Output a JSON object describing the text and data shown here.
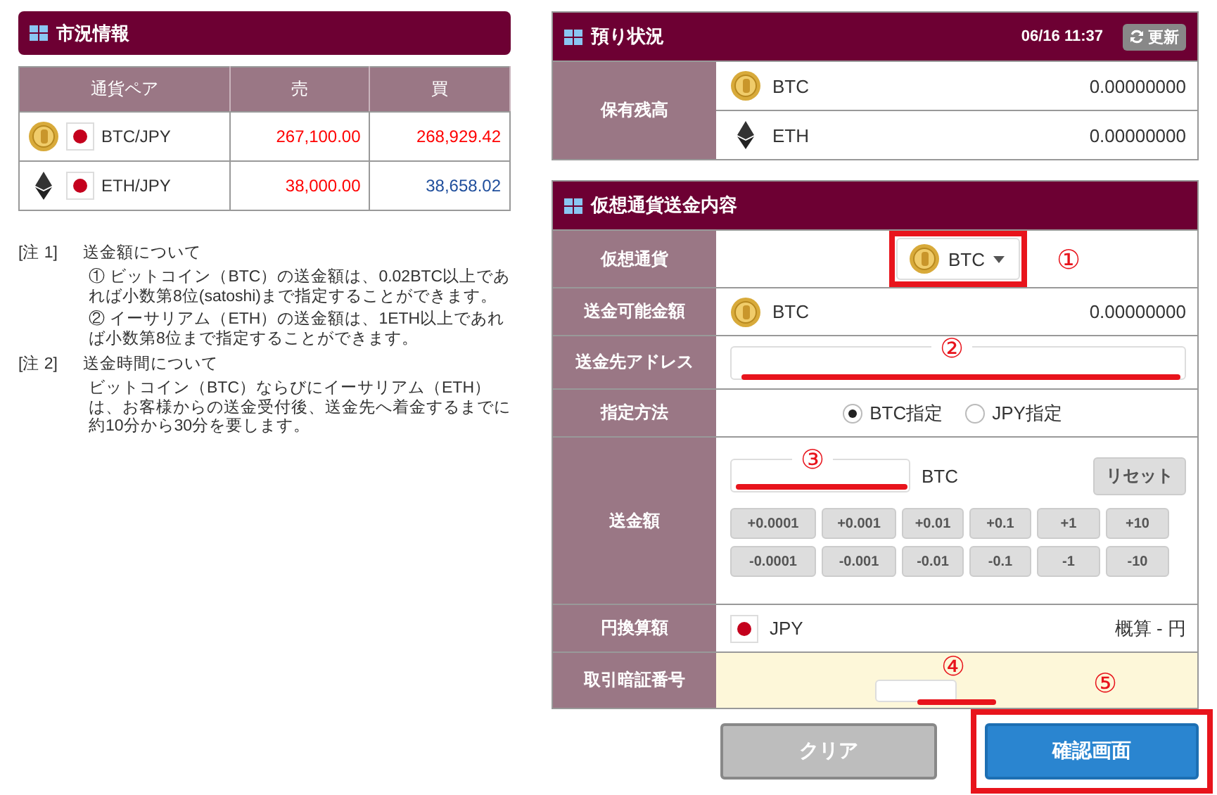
{
  "market": {
    "title": "市況情報",
    "columns": [
      "通貨ペア",
      "売",
      "買"
    ],
    "rows": [
      {
        "kind": "btc",
        "pair": "BTC/JPY",
        "sell": {
          "text": "267,100.00",
          "color": "#ff0000"
        },
        "buy": {
          "text": "268,929.42",
          "color": "#ff0000"
        }
      },
      {
        "kind": "eth",
        "pair": "ETH/JPY",
        "sell": {
          "text": "38,000.00",
          "color": "#ff0000"
        },
        "buy": {
          "text": "38,658.02",
          "color": "#1f4e9c"
        }
      }
    ]
  },
  "notes": [
    {
      "label": "[注 1]",
      "title": "送金額について",
      "paragraphs": [
        "① ビットコイン（BTC）の送金額は、0.02BTC以上であれば小数第8位(satoshi)まで指定することができます。",
        "② イーサリアム（ETH）の送金額は、1ETH以上であれば小数第8位まで指定することができます。"
      ]
    },
    {
      "label": "[注 2]",
      "title": "送金時間について",
      "paragraphs": [
        "ビットコイン（BTC）ならびにイーサリアム（ETH）は、お客様からの送金受付後、送金先へ着金するまでに約10分から30分を要します。"
      ]
    }
  ],
  "holdings": {
    "title": "預り状況",
    "timestamp": "06/16 11:37",
    "refresh": "更新",
    "label": "保有残高",
    "rows": [
      {
        "kind": "btc",
        "name": "BTC",
        "amount": "0.00000000"
      },
      {
        "kind": "eth",
        "name": "ETH",
        "amount": "0.00000000"
      }
    ]
  },
  "transfer": {
    "title": "仮想通貨送金内容",
    "rows": [
      {
        "kind": "select",
        "label": "仮想通貨",
        "value": "BTC",
        "highlighted": true,
        "marker": "①"
      },
      {
        "kind": "balance",
        "label": "送金可能金額",
        "name": "BTC",
        "amount": "0.00000000"
      },
      {
        "kind": "address",
        "label": "送金先アドレス",
        "marker": "②",
        "underlined": true
      },
      {
        "kind": "radio",
        "label": "指定方法",
        "options": [
          {
            "label": "BTC指定",
            "selected": true
          },
          {
            "label": "JPY指定",
            "selected": false
          }
        ]
      },
      {
        "kind": "amount",
        "label": "送金額",
        "unit": "BTC",
        "marker": "③",
        "underlined": true,
        "reset": "リセット",
        "steps": [
          [
            "+0.0001",
            "+0.001",
            "+0.01",
            "+0.1",
            "+1",
            "+10"
          ],
          [
            "-0.0001",
            "-0.001",
            "-0.01",
            "-0.1",
            "-1",
            "-10"
          ]
        ]
      },
      {
        "kind": "yen",
        "label": "円換算額",
        "name": "JPY",
        "estimate": "概算 - 円"
      },
      {
        "kind": "pin",
        "label": "取引暗証番号",
        "marker": "④",
        "underlined": true,
        "side_marker": "⑤"
      }
    ]
  },
  "buttons": [
    {
      "kind": "clear",
      "label": "クリア"
    },
    {
      "kind": "confirm",
      "label": "確認画面",
      "highlighted": true
    }
  ]
}
